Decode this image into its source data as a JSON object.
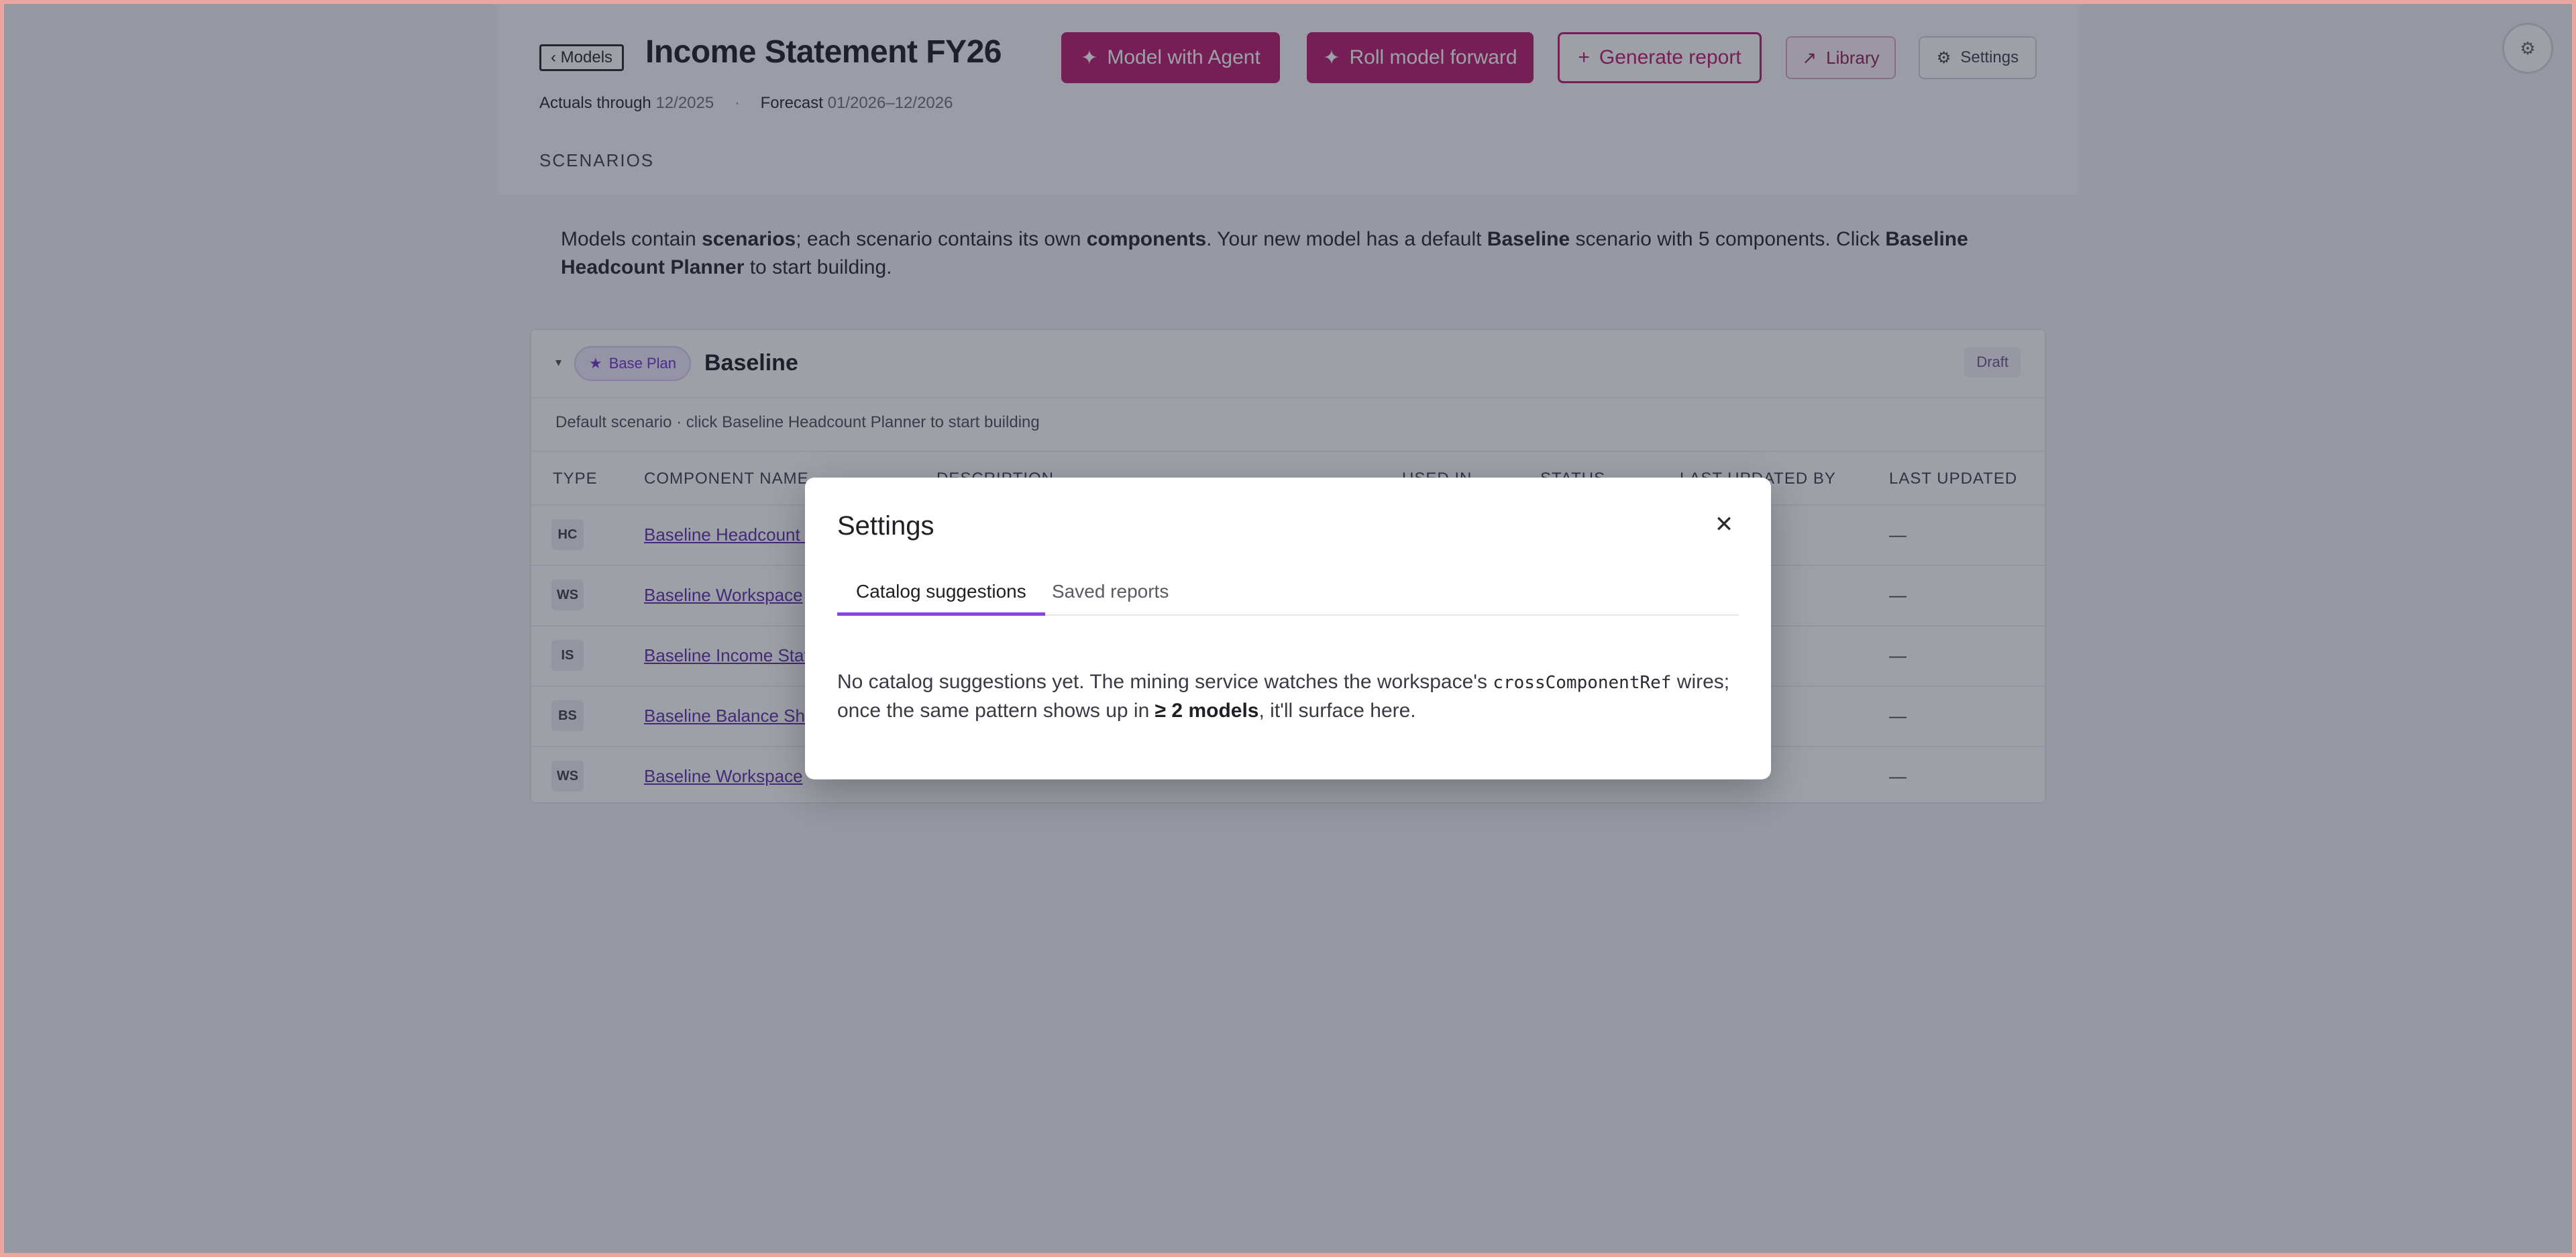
{
  "header": {
    "back_label": "‹ Models",
    "title": "Income Statement FY26",
    "actuals_label": "Actuals through",
    "actuals_value": "12/2025",
    "forecast_label": "Forecast",
    "forecast_value": "01/2026–12/2026",
    "separator": "·"
  },
  "toolbar": {
    "model_agent": {
      "icon": "✦",
      "label": "Model with Agent"
    },
    "roll_forward": {
      "icon": "✦",
      "label": "Roll model forward"
    },
    "generate_report": {
      "icon": "+",
      "label": "Generate report"
    },
    "library": {
      "icon": "↗",
      "label": "Library"
    },
    "settings": {
      "icon": "⚙",
      "label": "Settings"
    }
  },
  "corner_icon": "⚙",
  "scenarios_label": "SCENARIOS",
  "intro": {
    "p1": "Models contain ",
    "b1": "scenarios",
    "p2": "; each scenario contains its own ",
    "b2": "components",
    "p3": ". Your new model has a default ",
    "b3": "Baseline",
    "p4": " scenario with 5 components. Click ",
    "b4": "Baseline Headcount Planner",
    "p5": " to start building."
  },
  "scenario": {
    "caret": "▾",
    "badge_icon": "★",
    "badge_label": "Base Plan",
    "name": "Baseline",
    "status": "Draft",
    "subtitle": "Default scenario · click Baseline Headcount Planner to start building"
  },
  "table": {
    "columns": [
      "TYPE",
      "COMPONENT NAME",
      "DESCRIPTION",
      "USED IN",
      "STATUS",
      "LAST UPDATED BY",
      "LAST UPDATED"
    ],
    "rows": [
      {
        "type": "HC",
        "name": "Baseline Headcount P",
        "last_updated": "—"
      },
      {
        "type": "WS",
        "name": "Baseline Workspace",
        "last_updated": "—"
      },
      {
        "type": "IS",
        "name": "Baseline Income State",
        "last_updated": "—"
      },
      {
        "type": "BS",
        "name": "Baseline Balance She",
        "last_updated": "—"
      },
      {
        "type": "WS",
        "name": "Baseline Workspace",
        "last_updated": "—"
      }
    ]
  },
  "modal": {
    "title": "Settings",
    "close_icon": "✕",
    "tabs": [
      {
        "label": "Catalog suggestions"
      },
      {
        "label": "Saved reports"
      }
    ],
    "body": {
      "t1": "No catalog suggestions yet. The mining service watches the workspace's ",
      "code": "crossComponentRef",
      "t2": " wires; once the same pattern shows up in ",
      "bold": "≥ 2 models",
      "t3": ", it'll surface here."
    }
  },
  "colors": {
    "brand": "#b5146a",
    "accent_purple": "#8a46e0",
    "link": "#5a2aa8"
  }
}
